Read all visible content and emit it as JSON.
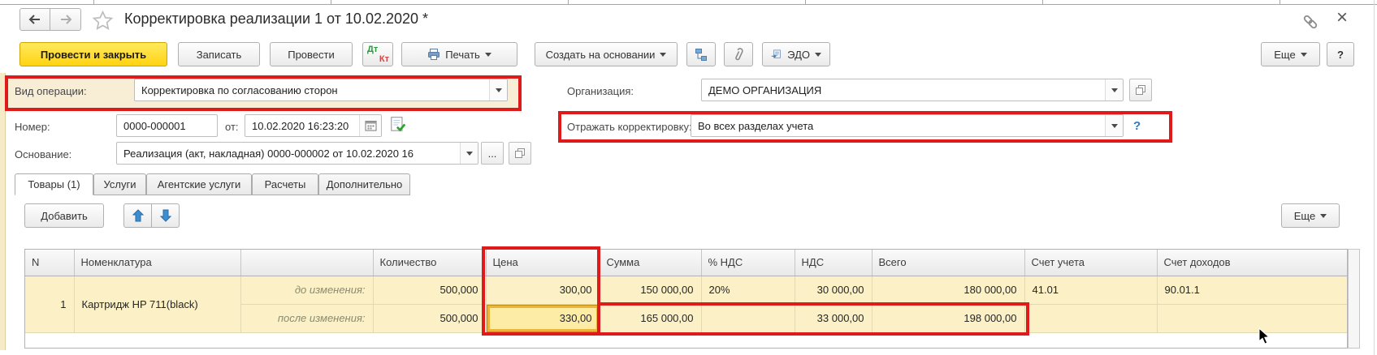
{
  "window": {
    "title": "Корректировка реализации 1 от 10.02.2020 *",
    "close_glyph": "×"
  },
  "toolbar": {
    "post_and_close": "Провести и закрыть",
    "save": "Записать",
    "post": "Провести",
    "dtkt": {
      "dt": "Дт",
      "kt": "Кт"
    },
    "print": "Печать",
    "create_based_on": "Создать на основании",
    "edo": "ЭДО",
    "more": "Еще",
    "help": "?"
  },
  "form": {
    "operation_kind": {
      "label": "Вид операции:",
      "value": "Корректировка по согласованию сторон"
    },
    "organization": {
      "label": "Организация:",
      "value": "ДЕМО ОРГАНИЗАЦИЯ"
    },
    "number": {
      "label": "Номер:",
      "value": "0000-000001"
    },
    "date": {
      "label": "от:",
      "value": "10.02.2020 16:23:20"
    },
    "reflect": {
      "label": "Отражать корректировку:",
      "value": "Во всех разделах учета",
      "help": "?"
    },
    "basis": {
      "label": "Основание:",
      "value": "Реализация (акт, накладная) 0000-000002 от 10.02.2020 16",
      "ellipsis": "..."
    }
  },
  "tabs": [
    {
      "label": "Товары (1)",
      "active": true
    },
    {
      "label": "Услуги",
      "active": false
    },
    {
      "label": "Агентские услуги",
      "active": false
    },
    {
      "label": "Расчеты",
      "active": false
    },
    {
      "label": "Дополнительно",
      "active": false
    }
  ],
  "table_toolbar": {
    "add": "Добавить",
    "more": "Еще"
  },
  "table": {
    "columns": [
      "N",
      "Номенклатура",
      "",
      "Количество",
      "Цена",
      "Сумма",
      "% НДС",
      "НДС",
      "Всего",
      "Счет учета",
      "Счет доходов"
    ],
    "rows": [
      {
        "n": "1",
        "nomenclature": "Картридж HP 711(black)",
        "change_label": "до изменения:",
        "qty": "500,000",
        "price": "300,00",
        "amount": "150 000,00",
        "vat_rate": "20%",
        "vat": "30 000,00",
        "total": "180 000,00",
        "account": "41.01",
        "income_account": "90.01.1"
      },
      {
        "n": "",
        "nomenclature": "",
        "change_label": "после изменения:",
        "qty": "500,000",
        "price": "330,00",
        "amount": "165 000,00",
        "vat_rate": "",
        "vat": "33 000,00",
        "total": "198 000,00",
        "account": "",
        "income_account": ""
      }
    ]
  },
  "colors": {
    "primary_button_yellow": "#ffd312",
    "annotation_red": "#de1a1a",
    "row_highlight_cream": "#fbf0c6",
    "selected_cell_amber": "#ecb53a",
    "help_blue": "#2f78c2"
  }
}
